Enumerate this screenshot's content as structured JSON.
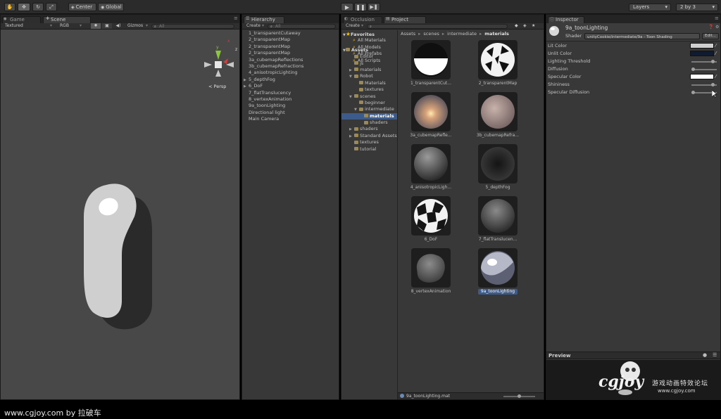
{
  "toolbar": {
    "pivot_label": "Center",
    "space_label": "Global",
    "layers_label": "Layers",
    "layout_label": "2 by 3"
  },
  "scene": {
    "tab_game": "Game",
    "tab_scene": "Scene",
    "draw_mode": "Textured",
    "render_mode": "RGB",
    "gizmos_label": "Gizmos",
    "search_placeholder": "All",
    "persp_label": "< Persp",
    "axis_x": "x",
    "axis_y": "y",
    "axis_z": "z"
  },
  "hierarchy": {
    "tab": "Hierarchy",
    "create_label": "Create",
    "search_placeholder": "All",
    "items": [
      {
        "label": "1_transparentCutaway",
        "arrow": ""
      },
      {
        "label": "2_transparentMap",
        "arrow": ""
      },
      {
        "label": "2_transparentMap",
        "arrow": ""
      },
      {
        "label": "2_transparentMap",
        "arrow": ""
      },
      {
        "label": "3a_cubemapReflections",
        "arrow": ""
      },
      {
        "label": "3b_cubemapRefractions",
        "arrow": ""
      },
      {
        "label": "4_anisotropicLighting",
        "arrow": ""
      },
      {
        "label": "5_depthFog",
        "arrow": "▶"
      },
      {
        "label": "6_DoF",
        "arrow": "▶"
      },
      {
        "label": "7_flatTranslucency",
        "arrow": ""
      },
      {
        "label": "8_vertexAnimation",
        "arrow": ""
      },
      {
        "label": "9a_toonLighting",
        "arrow": ""
      },
      {
        "label": "Directional light",
        "arrow": ""
      },
      {
        "label": "Main Camera",
        "arrow": ""
      }
    ]
  },
  "project": {
    "tab_occlusion": "Occlusion",
    "tab_project": "Project",
    "create_label": "Create",
    "favorites_label": "Favorites",
    "favorites": [
      "All Materials",
      "All Models",
      "All Prefabs",
      "All Scripts"
    ],
    "assets_label": "Assets",
    "tree": [
      {
        "label": "Editor",
        "indent": 1,
        "arrow": ""
      },
      {
        "label": "js",
        "indent": 1,
        "arrow": ""
      },
      {
        "label": "materials",
        "indent": 1,
        "arrow": "▶"
      },
      {
        "label": "Robot",
        "indent": 1,
        "arrow": "▼"
      },
      {
        "label": "Materials",
        "indent": 2,
        "arrow": ""
      },
      {
        "label": "textures",
        "indent": 2,
        "arrow": ""
      },
      {
        "label": "scenes",
        "indent": 1,
        "arrow": "▼"
      },
      {
        "label": "beginner",
        "indent": 2,
        "arrow": ""
      },
      {
        "label": "intermediate",
        "indent": 2,
        "arrow": "▼"
      },
      {
        "label": "materials",
        "indent": 3,
        "arrow": "",
        "selected": true
      },
      {
        "label": "shaders",
        "indent": 3,
        "arrow": ""
      },
      {
        "label": "shaders",
        "indent": 1,
        "arrow": "▶"
      },
      {
        "label": "Standard Assets",
        "indent": 1,
        "arrow": "▶"
      },
      {
        "label": "textures",
        "indent": 1,
        "arrow": ""
      },
      {
        "label": "tutorial",
        "indent": 1,
        "arrow": ""
      }
    ],
    "breadcrumb": [
      "Assets",
      "scenes",
      "intermediate",
      "materials"
    ],
    "breadcrumb_sep": "▸",
    "materials": [
      {
        "label": "1_transparentCut...",
        "kind": "half"
      },
      {
        "label": "2_transparentMap",
        "kind": "holes"
      },
      {
        "label": "3a_cubemapRefle...",
        "kind": "sunset"
      },
      {
        "label": "3b_cubemapRefra...",
        "kind": "pink"
      },
      {
        "label": "4_anisotropicLigh...",
        "kind": "grey"
      },
      {
        "label": "5_depthFog",
        "kind": "dark"
      },
      {
        "label": "6_DoF",
        "kind": "checker"
      },
      {
        "label": "7_flatTranslucen...",
        "kind": "grey2"
      },
      {
        "label": "8_vertexAnimation",
        "kind": "blob"
      },
      {
        "label": "9a_toonLighting",
        "kind": "toon",
        "selected": true
      }
    ],
    "status_file": "9a_toonLighting.mat"
  },
  "inspector": {
    "tab": "Inspector",
    "material_name": "9a_toonLighting",
    "shader_label": "Shader",
    "shader_value": "unityCookie/intermediate/9a - Toon Shading",
    "edit_label": "Edit...",
    "props": [
      {
        "label": "Lit Color",
        "kind": "color",
        "color": "#cfcfcf"
      },
      {
        "label": "Unlit Color",
        "kind": "color",
        "color": "#101a30"
      },
      {
        "label": "Lighting Threshold",
        "kind": "slider"
      },
      {
        "label": "Diffusion",
        "kind": "slider"
      },
      {
        "label": "Specular Color",
        "kind": "color",
        "color": "#ffffff"
      },
      {
        "label": "Shininess",
        "kind": "slider"
      },
      {
        "label": "Specular Diffusion",
        "kind": "slider"
      }
    ],
    "preview_label": "Preview"
  },
  "watermark": {
    "logo_text": "cgjoy",
    "cn_text": "游戏动画特效论坛",
    "url": "www.cgjoy.com"
  },
  "footer": {
    "credit": "www.cgjoy.com by 拉破车"
  }
}
